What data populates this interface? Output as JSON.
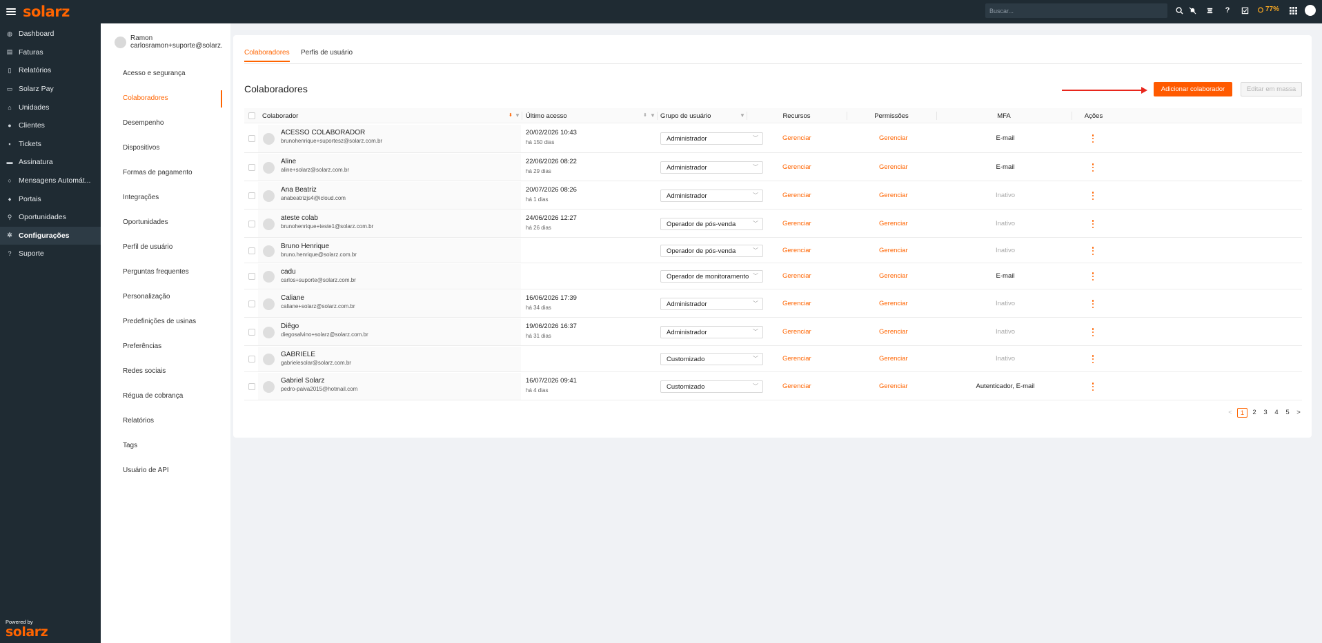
{
  "topbar": {
    "logo_text": "solarz",
    "search_placeholder": "Buscar...",
    "battery": "77%",
    "icons": [
      "search-icon",
      "bell-off-icon",
      "sort-icon",
      "help-icon",
      "tasks-icon",
      "apps-icon"
    ]
  },
  "sidebar": {
    "items": [
      {
        "label": "Dashboard",
        "icon": "dashboard-icon"
      },
      {
        "label": "Faturas",
        "icon": "invoice-icon"
      },
      {
        "label": "Relatórios",
        "icon": "report-icon"
      },
      {
        "label": "Solarz Pay",
        "icon": "wallet-icon"
      },
      {
        "label": "Unidades",
        "icon": "home-icon"
      },
      {
        "label": "Clientes",
        "icon": "user-icon"
      },
      {
        "label": "Tickets",
        "icon": "ticket-icon"
      },
      {
        "label": "Assinatura",
        "icon": "card-icon"
      },
      {
        "label": "Mensagens Automát...",
        "icon": "whatsapp-icon"
      },
      {
        "label": "Portais",
        "icon": "pin-icon"
      },
      {
        "label": "Oportunidades",
        "icon": "search-icon"
      },
      {
        "label": "Configurações",
        "icon": "gear-icon"
      },
      {
        "label": "Suporte",
        "icon": "help-icon"
      }
    ],
    "powered_by": "Powered by",
    "powered_logo": "solarz"
  },
  "settings": {
    "user_name": "Ramon",
    "user_email": "carlosramon+suporte@solarz.com.br",
    "items": [
      "Acesso e segurança",
      "Colaboradores",
      "Desempenho",
      "Dispositivos",
      "Formas de pagamento",
      "Integrações",
      "Oportunidades",
      "Perfil de usuário",
      "Perguntas frequentes",
      "Personalização",
      "Predefinições de usinas",
      "Preferências",
      "Redes sociais",
      "Régua de cobrança",
      "Relatórios",
      "Tags",
      "Usuário de API"
    ],
    "active": "Colaboradores"
  },
  "main": {
    "tabs": [
      "Colaboradores",
      "Perfis de usuário"
    ],
    "title": "Colaboradores",
    "add_button": "Adicionar colaborador",
    "mass_button": "Editar em massa",
    "columns": [
      "Colaborador",
      "Último acesso",
      "Grupo de usuário",
      "Recursos",
      "Permissões",
      "MFA",
      "Ações"
    ],
    "link_label": "Gerenciar",
    "rows": [
      {
        "name": "ACESSO COLABORADOR",
        "email": "brunohenrique+suportesz@solarz.com.br",
        "date": "20/02/2026 10:43",
        "ago": "há 150 dias",
        "group": "Administrador",
        "mfa": "E-mail"
      },
      {
        "name": "Aline",
        "email": "aline+solarz@solarz.com.br",
        "date": "22/06/2026 08:22",
        "ago": "há 29 dias",
        "group": "Administrador",
        "mfa": "E-mail"
      },
      {
        "name": "Ana Beatriz",
        "email": "anabeatrizjs4@icloud.com",
        "date": "20/07/2026 08:26",
        "ago": "há 1 dias",
        "group": "Administrador",
        "mfa": "Inativo"
      },
      {
        "name": "ateste colab",
        "email": "brunohenrique+teste1@solarz.com.br",
        "date": "24/06/2026 12:27",
        "ago": "há 26 dias",
        "group": "Operador de pós-venda",
        "mfa": "Inativo"
      },
      {
        "name": "Bruno Henrique",
        "email": "bruno.henrique@solarz.com.br",
        "date": "",
        "ago": "",
        "group": "Operador de pós-venda",
        "mfa": "Inativo"
      },
      {
        "name": "cadu",
        "email": "carlos+suporte@solarz.com.br",
        "date": "",
        "ago": "",
        "group": "Operador de monitoramento",
        "mfa": "E-mail"
      },
      {
        "name": "Caliane",
        "email": "caliane+solarz@solarz.com.br",
        "date": "16/06/2026 17:39",
        "ago": "há 34 dias",
        "group": "Administrador",
        "mfa": "Inativo"
      },
      {
        "name": "Diêgo",
        "email": "diegosalvino+solarz@solarz.com.br",
        "date": "19/06/2026 16:37",
        "ago": "há 31 dias",
        "group": "Administrador",
        "mfa": "Inativo"
      },
      {
        "name": "GABRIELE",
        "email": "gabrielesolar@solarz.com.br",
        "date": "",
        "ago": "",
        "group": "Customizado",
        "mfa": "Inativo"
      },
      {
        "name": "Gabriel Solarz",
        "email": "pedro-paiva2015@hotmail.com",
        "date": "16/07/2026 09:41",
        "ago": "há 4 dias",
        "group": "Customizado",
        "mfa": "Autenticador, E-mail"
      }
    ],
    "pagination": {
      "prev": "<",
      "pages": [
        "1",
        "2",
        "3",
        "4",
        "5"
      ],
      "current": "1",
      "next": ">"
    }
  },
  "colors": {
    "accent": "#ff6400",
    "sidebar_bg": "#1f2b33",
    "arrow": "#e8261c"
  }
}
